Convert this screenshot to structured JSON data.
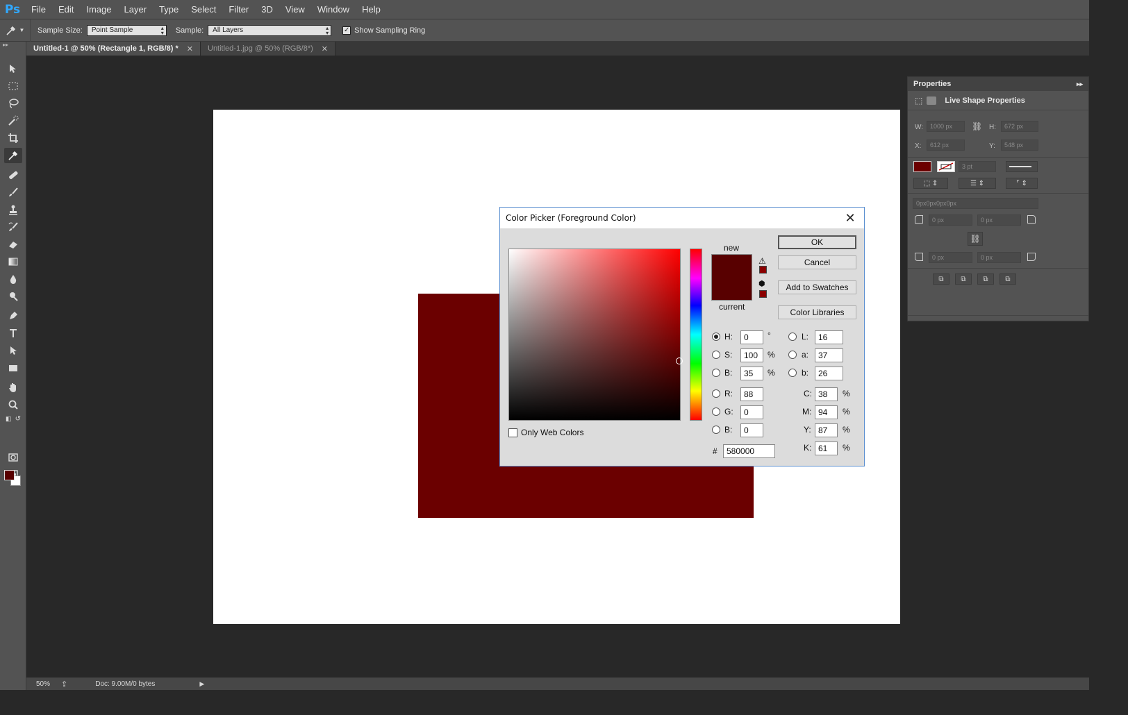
{
  "app": {
    "logo": "Ps"
  },
  "menu": [
    "File",
    "Edit",
    "Image",
    "Layer",
    "Type",
    "Select",
    "Filter",
    "3D",
    "View",
    "Window",
    "Help"
  ],
  "options": {
    "sample_size_label": "Sample Size:",
    "sample_size_value": "Point Sample",
    "sample_label": "Sample:",
    "sample_value": "All Layers",
    "sampling_ring_label": "Show Sampling Ring",
    "sampling_ring_checked": true
  },
  "tabs": [
    {
      "label": "Untitled-1 @ 50% (Rectangle 1, RGB/8) *",
      "active": true
    },
    {
      "label": "Untitled-1.jpg @ 50% (RGB/8*)",
      "active": false
    }
  ],
  "status": {
    "zoom": "50%",
    "doc": "Doc: 9.00M/0 bytes"
  },
  "properties": {
    "title": "Properties",
    "subtitle": "Live Shape Properties",
    "w_label": "W:",
    "w_value": "1000 px",
    "h_label": "H:",
    "h_value": "672 px",
    "x_label": "X:",
    "x_value": "612 px",
    "y_label": "Y:",
    "y_value": "548 px",
    "stroke_width": "3 pt",
    "corner_all": "0px0px0px0px",
    "corner_tl": "0 px",
    "corner_tr": "0 px",
    "corner_bl": "0 px",
    "corner_br": "0 px",
    "fill_color": "#6b0000"
  },
  "dialog": {
    "title": "Color Picker (Foreground Color)",
    "close_glyph": "✕",
    "new_label": "new",
    "current_label": "current",
    "ok": "OK",
    "cancel": "Cancel",
    "add_swatches": "Add to Swatches",
    "color_libraries": "Color Libraries",
    "only_web_colors": "Only Web Colors",
    "hsb": {
      "h_label": "H:",
      "h": "0",
      "h_unit": "°",
      "s_label": "S:",
      "s": "100",
      "s_unit": "%",
      "b_label": "B:",
      "b": "35",
      "b_unit": "%"
    },
    "rgb": {
      "r_label": "R:",
      "r": "88",
      "g_label": "G:",
      "g": "0",
      "b_label": "B:",
      "b": "0"
    },
    "lab": {
      "l_label": "L:",
      "l": "16",
      "a_label": "a:",
      "a": "37",
      "b_label": "b:",
      "b": "26"
    },
    "cmyk": {
      "c_label": "C:",
      "c": "38",
      "m_label": "M:",
      "m": "94",
      "y_label": "Y:",
      "y": "87",
      "k_label": "K:",
      "k": "61",
      "unit": "%"
    },
    "hex_label": "#",
    "hex": "580000",
    "selected_mode": "H",
    "current_color": "#580000"
  }
}
